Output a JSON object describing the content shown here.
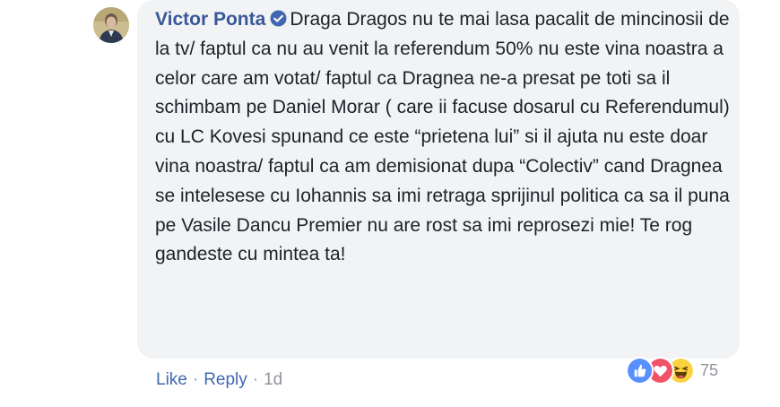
{
  "comment": {
    "author": "Victor Ponta",
    "text": "Draga Dragos nu te mai lasa pacalit de mincinosii de la tv/ faptul ca nu au venit la referendum 50% nu este vina noastra a celor care am votat/ faptul ca Dragnea ne-a presat pe toti sa il schimbam pe Daniel Morar ( care ii facuse dosarul cu Referendumul) cu LC Kovesi spunand ce este “prietena lui” si il ajuta nu este doar vina noastra/ faptul ca am demisionat dupa “Colectiv” cand Dragnea se intelesese cu Iohannis sa imi retraga sprijinul politica ca sa il puna pe Vasile Dancu Premier nu are rost sa imi reprosezi mie! Te rog gandeste cu mintea ta!",
    "verified_icon": "verified-badge-icon"
  },
  "actions": {
    "like_label": "Like",
    "separator": "·",
    "reply_label": "Reply",
    "timestamp": "1d"
  },
  "reactions": {
    "count": "75",
    "icons": [
      "like-reaction-icon",
      "love-reaction-icon",
      "haha-reaction-icon"
    ],
    "colors": {
      "like": "#5890ff",
      "love": "#f25268",
      "haha": "#fcd240"
    }
  },
  "colors": {
    "author": "#385898",
    "link": "#4267b2",
    "muted": "#90949c",
    "bubble": "#f2f3f5"
  }
}
